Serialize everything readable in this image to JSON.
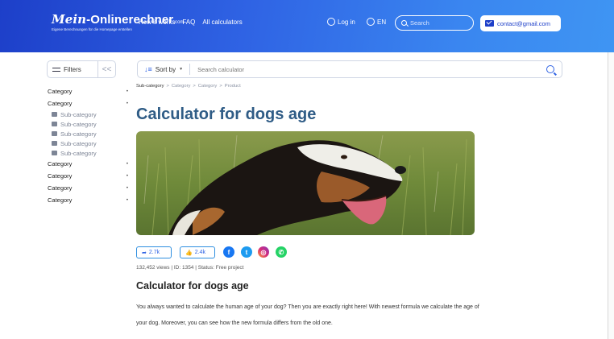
{
  "header": {
    "logo_script": "Mein",
    "logo_main": "-Onlinerechner",
    "logo_suffix": ".com",
    "logo_tagline": "Eigene Berechnungen für die Homepage erstellen",
    "nav": [
      "How it works",
      "FAQ",
      "All calculators"
    ],
    "login_label": "Log in",
    "lang_label": "EN",
    "search_placeholder": "Search",
    "contact_label": "contact@gmail.com"
  },
  "sidebar": {
    "filters_label": "Filters",
    "collapse_label": "<<",
    "categories_top": [
      "Category",
      "Category"
    ],
    "subcategories": [
      "Sub-category",
      "Sub-category",
      "Sub-category",
      "Sub-category",
      "Sub-category"
    ],
    "categories_bottom": [
      "Category",
      "Category",
      "Category",
      "Category"
    ]
  },
  "toolbar": {
    "sort_label": "Sort by",
    "search_placeholder": "Search calculator"
  },
  "breadcrumb": [
    "Sub-category",
    "Category",
    "Category",
    "Product"
  ],
  "page": {
    "title": "Calculator for dogs age",
    "shares_count": "2.7k",
    "likes_count": "2.4k",
    "meta": "132,452 views | ID: 1354 | Status: Free project",
    "section_title": "Calculator for dogs age",
    "paragraph": "You always wanted to calculate the human age of your dog? Then you are exactly right here! With newest formula we calculate the age of your dog. Moreover, you can see how the new formula differs from the old one."
  },
  "colors": {
    "brand_blue": "#2f63e4",
    "title_blue": "#2f5c86",
    "facebook": "#1877f2",
    "twitter": "#1d9bf0",
    "instagram": "#d6297a",
    "whatsapp": "#25d366"
  }
}
